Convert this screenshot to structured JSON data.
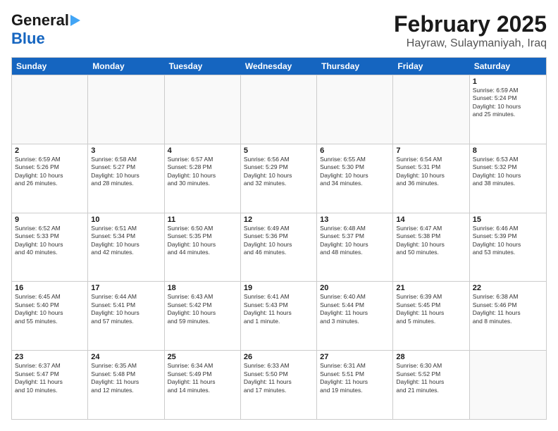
{
  "header": {
    "logo_general": "General",
    "logo_blue": "Blue",
    "month": "February 2025",
    "location": "Hayraw, Sulaymaniyah, Iraq"
  },
  "days_of_week": [
    "Sunday",
    "Monday",
    "Tuesday",
    "Wednesday",
    "Thursday",
    "Friday",
    "Saturday"
  ],
  "weeks": [
    [
      {
        "day": "",
        "text": ""
      },
      {
        "day": "",
        "text": ""
      },
      {
        "day": "",
        "text": ""
      },
      {
        "day": "",
        "text": ""
      },
      {
        "day": "",
        "text": ""
      },
      {
        "day": "",
        "text": ""
      },
      {
        "day": "1",
        "text": "Sunrise: 6:59 AM\nSunset: 5:24 PM\nDaylight: 10 hours\nand 25 minutes."
      }
    ],
    [
      {
        "day": "2",
        "text": "Sunrise: 6:59 AM\nSunset: 5:26 PM\nDaylight: 10 hours\nand 26 minutes."
      },
      {
        "day": "3",
        "text": "Sunrise: 6:58 AM\nSunset: 5:27 PM\nDaylight: 10 hours\nand 28 minutes."
      },
      {
        "day": "4",
        "text": "Sunrise: 6:57 AM\nSunset: 5:28 PM\nDaylight: 10 hours\nand 30 minutes."
      },
      {
        "day": "5",
        "text": "Sunrise: 6:56 AM\nSunset: 5:29 PM\nDaylight: 10 hours\nand 32 minutes."
      },
      {
        "day": "6",
        "text": "Sunrise: 6:55 AM\nSunset: 5:30 PM\nDaylight: 10 hours\nand 34 minutes."
      },
      {
        "day": "7",
        "text": "Sunrise: 6:54 AM\nSunset: 5:31 PM\nDaylight: 10 hours\nand 36 minutes."
      },
      {
        "day": "8",
        "text": "Sunrise: 6:53 AM\nSunset: 5:32 PM\nDaylight: 10 hours\nand 38 minutes."
      }
    ],
    [
      {
        "day": "9",
        "text": "Sunrise: 6:52 AM\nSunset: 5:33 PM\nDaylight: 10 hours\nand 40 minutes."
      },
      {
        "day": "10",
        "text": "Sunrise: 6:51 AM\nSunset: 5:34 PM\nDaylight: 10 hours\nand 42 minutes."
      },
      {
        "day": "11",
        "text": "Sunrise: 6:50 AM\nSunset: 5:35 PM\nDaylight: 10 hours\nand 44 minutes."
      },
      {
        "day": "12",
        "text": "Sunrise: 6:49 AM\nSunset: 5:36 PM\nDaylight: 10 hours\nand 46 minutes."
      },
      {
        "day": "13",
        "text": "Sunrise: 6:48 AM\nSunset: 5:37 PM\nDaylight: 10 hours\nand 48 minutes."
      },
      {
        "day": "14",
        "text": "Sunrise: 6:47 AM\nSunset: 5:38 PM\nDaylight: 10 hours\nand 50 minutes."
      },
      {
        "day": "15",
        "text": "Sunrise: 6:46 AM\nSunset: 5:39 PM\nDaylight: 10 hours\nand 53 minutes."
      }
    ],
    [
      {
        "day": "16",
        "text": "Sunrise: 6:45 AM\nSunset: 5:40 PM\nDaylight: 10 hours\nand 55 minutes."
      },
      {
        "day": "17",
        "text": "Sunrise: 6:44 AM\nSunset: 5:41 PM\nDaylight: 10 hours\nand 57 minutes."
      },
      {
        "day": "18",
        "text": "Sunrise: 6:43 AM\nSunset: 5:42 PM\nDaylight: 10 hours\nand 59 minutes."
      },
      {
        "day": "19",
        "text": "Sunrise: 6:41 AM\nSunset: 5:43 PM\nDaylight: 11 hours\nand 1 minute."
      },
      {
        "day": "20",
        "text": "Sunrise: 6:40 AM\nSunset: 5:44 PM\nDaylight: 11 hours\nand 3 minutes."
      },
      {
        "day": "21",
        "text": "Sunrise: 6:39 AM\nSunset: 5:45 PM\nDaylight: 11 hours\nand 5 minutes."
      },
      {
        "day": "22",
        "text": "Sunrise: 6:38 AM\nSunset: 5:46 PM\nDaylight: 11 hours\nand 8 minutes."
      }
    ],
    [
      {
        "day": "23",
        "text": "Sunrise: 6:37 AM\nSunset: 5:47 PM\nDaylight: 11 hours\nand 10 minutes."
      },
      {
        "day": "24",
        "text": "Sunrise: 6:35 AM\nSunset: 5:48 PM\nDaylight: 11 hours\nand 12 minutes."
      },
      {
        "day": "25",
        "text": "Sunrise: 6:34 AM\nSunset: 5:49 PM\nDaylight: 11 hours\nand 14 minutes."
      },
      {
        "day": "26",
        "text": "Sunrise: 6:33 AM\nSunset: 5:50 PM\nDaylight: 11 hours\nand 17 minutes."
      },
      {
        "day": "27",
        "text": "Sunrise: 6:31 AM\nSunset: 5:51 PM\nDaylight: 11 hours\nand 19 minutes."
      },
      {
        "day": "28",
        "text": "Sunrise: 6:30 AM\nSunset: 5:52 PM\nDaylight: 11 hours\nand 21 minutes."
      },
      {
        "day": "",
        "text": ""
      }
    ]
  ]
}
